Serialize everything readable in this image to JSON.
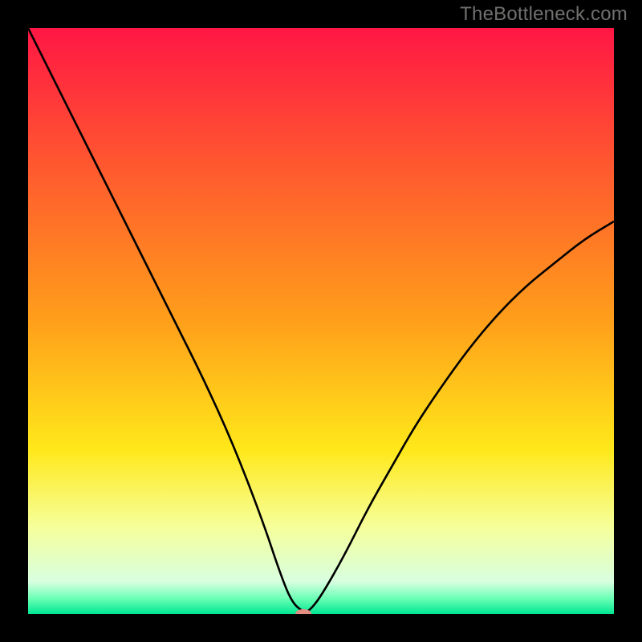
{
  "watermark": "TheBottleneck.com",
  "chart_data": {
    "type": "line",
    "title": "",
    "xlabel": "",
    "ylabel": "",
    "xlim": [
      0,
      100
    ],
    "ylim": [
      0,
      100
    ],
    "background_gradient_stops": [
      {
        "offset": 0.0,
        "color": "#ff1744"
      },
      {
        "offset": 0.25,
        "color": "#ff5c2e"
      },
      {
        "offset": 0.5,
        "color": "#ff9f1a"
      },
      {
        "offset": 0.72,
        "color": "#ffe81a"
      },
      {
        "offset": 0.85,
        "color": "#f6ff99"
      },
      {
        "offset": 0.945,
        "color": "#d8ffe0"
      },
      {
        "offset": 0.975,
        "color": "#66ffb3"
      },
      {
        "offset": 1.0,
        "color": "#00e693"
      }
    ],
    "series": [
      {
        "name": "bottleneck-curve",
        "type": "line",
        "color": "#000000",
        "stroke_width": 2.6,
        "x": [
          0,
          5,
          10,
          15,
          20,
          25,
          30,
          35,
          40,
          43,
          45,
          47,
          48,
          50,
          54,
          58,
          62,
          66,
          70,
          75,
          80,
          85,
          90,
          95,
          100
        ],
        "y": [
          100,
          90,
          80,
          70,
          60,
          50,
          40,
          29,
          16,
          7,
          2,
          0.3,
          0.5,
          3,
          10,
          18,
          25,
          32,
          38,
          45,
          51,
          56,
          60,
          64,
          67
        ]
      }
    ],
    "markers": [
      {
        "name": "optimal-point",
        "x": 47,
        "y": 0.0,
        "color": "#e38c82",
        "rx": 10,
        "ry": 6
      }
    ]
  }
}
